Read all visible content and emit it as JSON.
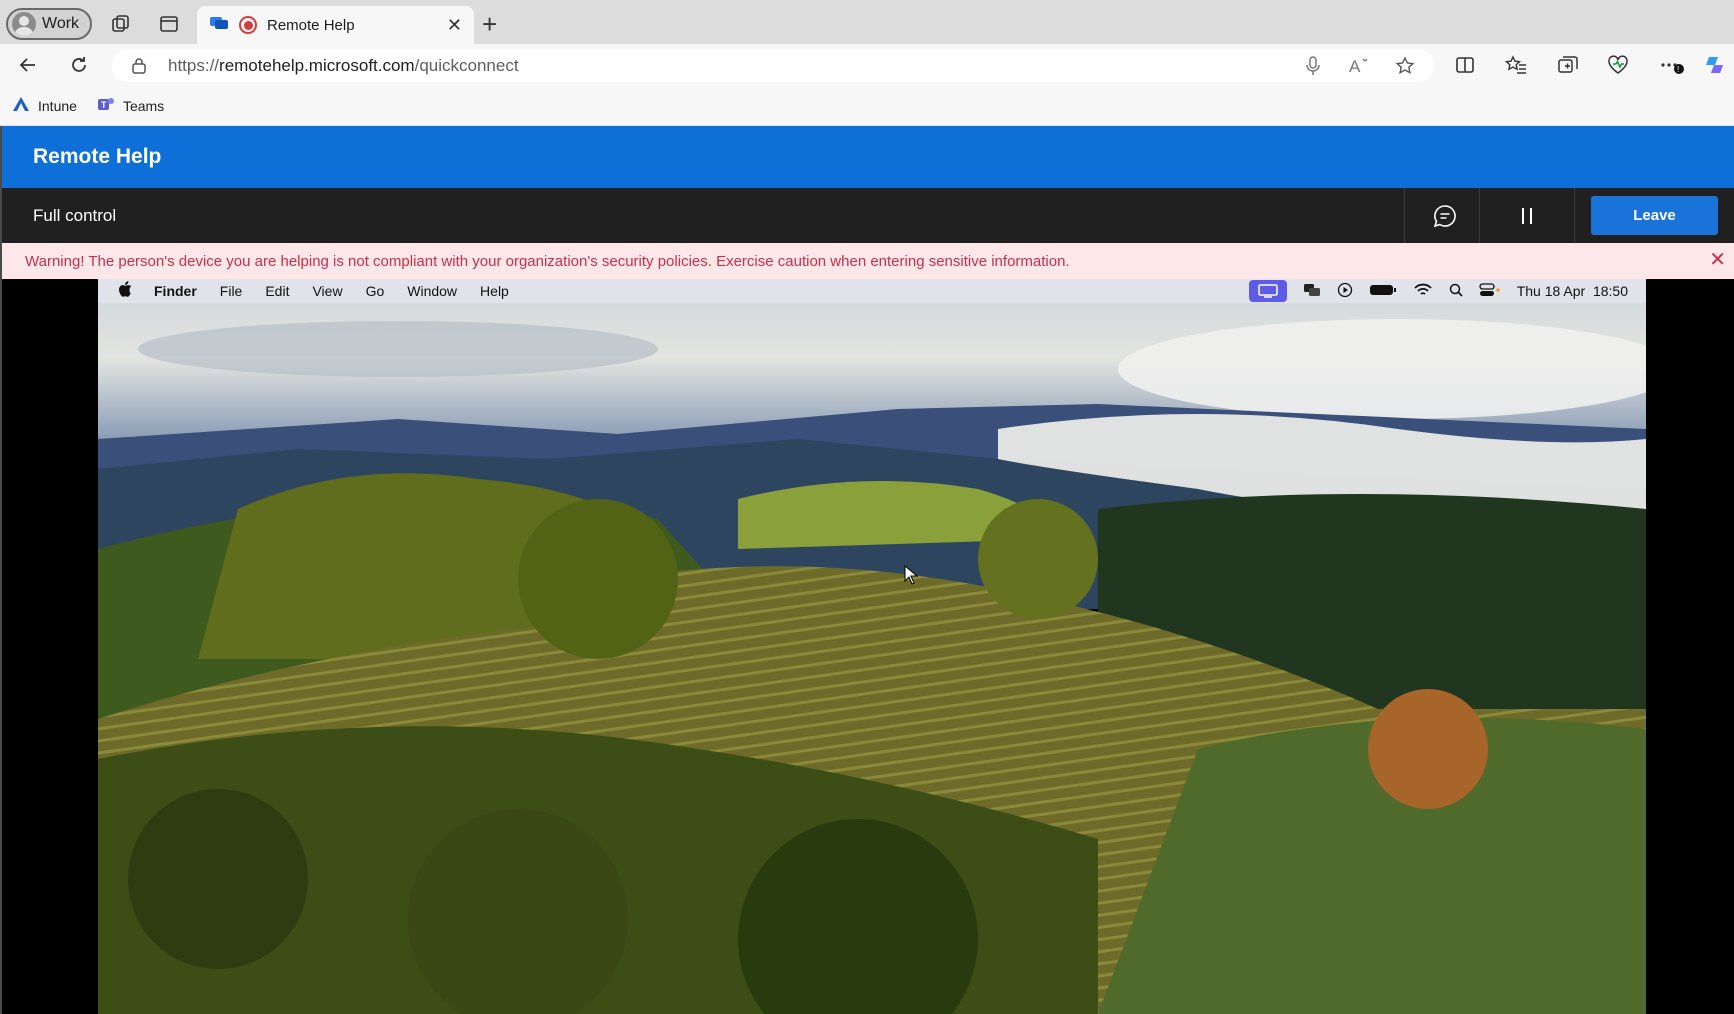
{
  "browser": {
    "profile_label": "Work",
    "tab_title": "Remote Help",
    "url_prefix": "https://",
    "url_host": "remotehelp.microsoft.com",
    "url_path": "/quickconnect",
    "favorites": [
      {
        "label": "Intune",
        "icon": "intune-icon"
      },
      {
        "label": "Teams",
        "icon": "teams-icon"
      }
    ]
  },
  "app": {
    "title": "Remote Help",
    "mode_label": "Full control",
    "leave_label": "Leave",
    "warning_text": "Warning! The person's device you are helping is not compliant with your organization's security policies. Exercise caution when entering sensitive information.",
    "colors": {
      "header": "#0f6fd9",
      "warning_text": "#c4314b",
      "warning_bg": "#fde7e9"
    }
  },
  "remote_screen": {
    "app_menu": [
      "Finder",
      "File",
      "Edit",
      "View",
      "Go",
      "Window",
      "Help"
    ],
    "datetime": "Thu 18 Apr  18:50",
    "wallpaper": "Sonoma vineyard landscape"
  }
}
